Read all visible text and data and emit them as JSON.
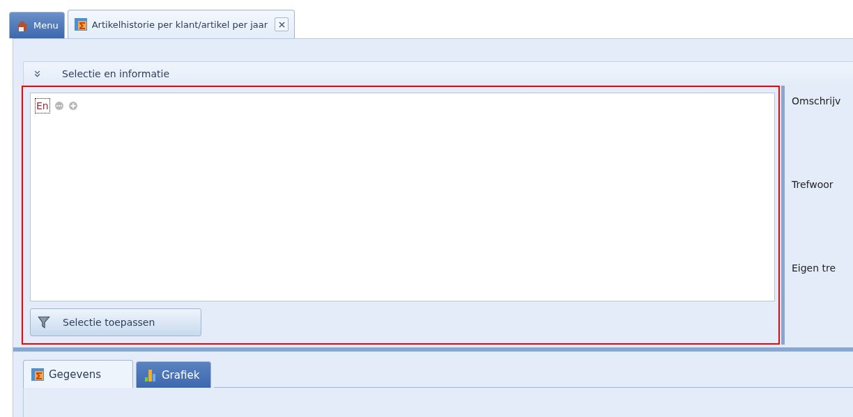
{
  "tabs": [
    {
      "label": "Menu",
      "kind": "home",
      "selected": false,
      "closable": false
    },
    {
      "label": "Artikelhistorie per klant/artikel per jaar",
      "kind": "report",
      "selected": true,
      "closable": true
    }
  ],
  "group": {
    "title": "Selectie en informatie",
    "expanded": true
  },
  "filter": {
    "operator": "En"
  },
  "apply_button": "Selectie toepassen",
  "info_labels": [
    "Omschrijv",
    "Trefwoor",
    "Eigen tre"
  ],
  "bottom_tabs": [
    {
      "label": "Gegevens",
      "kind": "report",
      "selected": true
    },
    {
      "label": "Grafiek",
      "kind": "chart",
      "selected": false
    }
  ]
}
